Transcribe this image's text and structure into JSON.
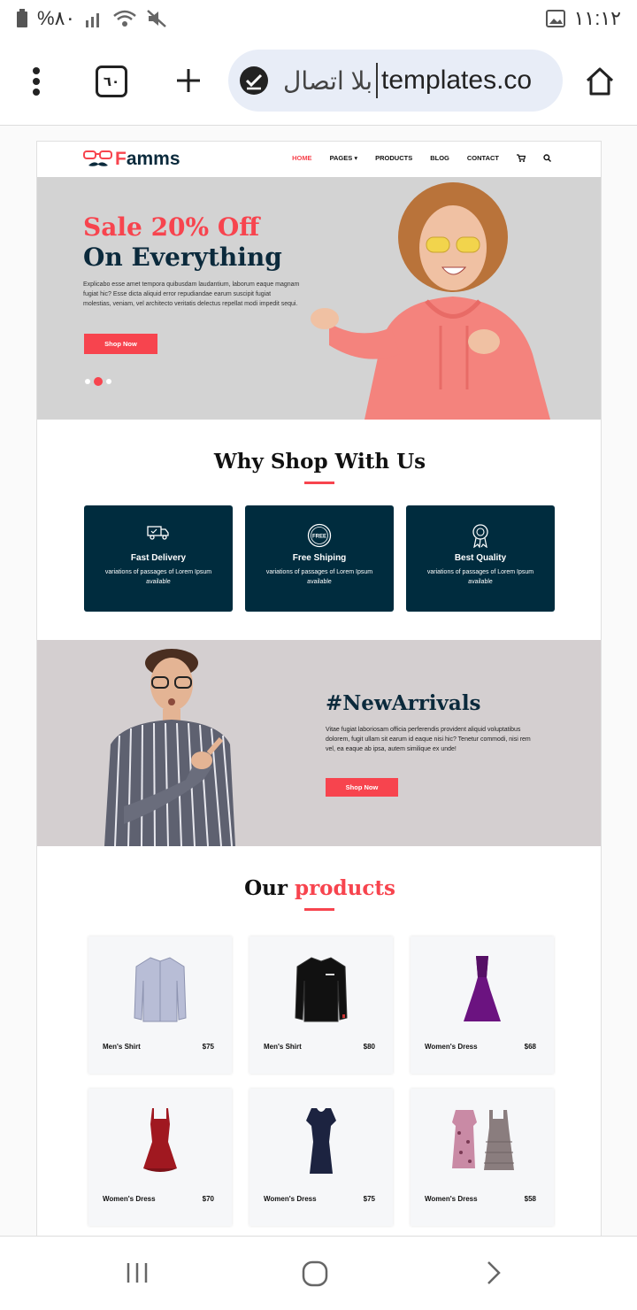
{
  "statusbar": {
    "battery": "%٨٠",
    "time": "١١:١٢"
  },
  "browser": {
    "tab_count": "٦٠",
    "url": "templates.co",
    "connection_label": "بلا اتصال"
  },
  "site": {
    "logo": {
      "first": "F",
      "rest": "amms"
    },
    "nav": [
      {
        "label": "HOME"
      },
      {
        "label": "PAGES ▾"
      },
      {
        "label": "PRODUCTS"
      },
      {
        "label": "BLOG"
      },
      {
        "label": "CONTACT"
      }
    ],
    "hero": {
      "title_line1": "Sale 20% Off",
      "title_line2": "On Everything",
      "text": "Explicabo esse amet tempora quibusdam laudantium, laborum eaque magnam fugiat hic? Esse dicta aliquid error repudiandae earum suscipit fugiat molestias, veniam, vel architecto veritatis delectus repellat modi impedit sequi.",
      "button": "Shop Now"
    },
    "why": {
      "title": "Why Shop With Us",
      "cards": [
        {
          "title": "Fast Delivery",
          "text": "variations of passages of Lorem Ipsum available",
          "icon": "truck-icon"
        },
        {
          "title": "Free Shiping",
          "text": "variations of passages of Lorem Ipsum available",
          "icon": "free-badge-icon"
        },
        {
          "title": "Best Quality",
          "text": "variations of passages of Lorem Ipsum available",
          "icon": "award-ribbon-icon"
        }
      ]
    },
    "arrivals": {
      "title": "#NewArrivals",
      "text": "Vitae fugiat laboriosam officia perferendis provident aliquid voluptatibus dolorem, fugit ullam sit earum id eaque nisi hic? Tenetur commodi, nisi rem vel, ea eaque ab ipsa, autem similique ex unde!",
      "button": "Shop Now"
    },
    "products": {
      "title_part1": "Our",
      "title_part2": "products",
      "items": [
        {
          "name": "Men's Shirt",
          "price": "$75",
          "image": "blue-shirt"
        },
        {
          "name": "Men's Shirt",
          "price": "$80",
          "image": "black-shirt"
        },
        {
          "name": "Women's Dress",
          "price": "$68",
          "image": "purple-gown"
        },
        {
          "name": "Women's Dress",
          "price": "$70",
          "image": "red-dress"
        },
        {
          "name": "Women's Dress",
          "price": "$75",
          "image": "navy-dress"
        },
        {
          "name": "Women's Dress",
          "price": "$58",
          "image": "two-dresses"
        }
      ]
    }
  },
  "colors": {
    "accent": "#f7444e",
    "navy": "#002c3e",
    "hero_bg": "#d3d3d3",
    "arrivals_bg": "#d4cfd0"
  }
}
